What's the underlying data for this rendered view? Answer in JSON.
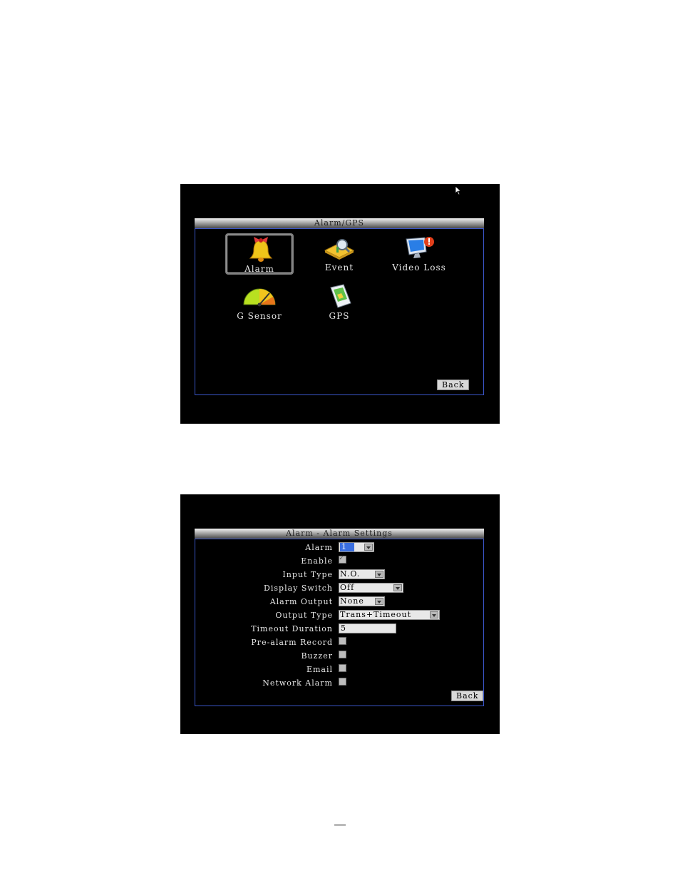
{
  "screen1": {
    "title": "Alarm/GPS",
    "items": [
      {
        "label": "Alarm",
        "icon": "bell-icon"
      },
      {
        "label": "Event",
        "icon": "event-icon"
      },
      {
        "label": "Video Loss",
        "icon": "monitor-alert-icon"
      },
      {
        "label": "G Sensor",
        "icon": "gauge-icon"
      },
      {
        "label": "GPS",
        "icon": "gps-device-icon"
      }
    ],
    "back_label": "Back"
  },
  "screen2": {
    "title": "Alarm - Alarm Settings",
    "fields": {
      "alarm": {
        "label": "Alarm",
        "value": "1"
      },
      "enable": {
        "label": "Enable",
        "checked": true
      },
      "input_type": {
        "label": "Input Type",
        "value": "N.O."
      },
      "display_switch": {
        "label": "Display Switch",
        "value": "Off"
      },
      "alarm_output": {
        "label": "Alarm Output",
        "value": "None"
      },
      "output_type": {
        "label": "Output Type",
        "value": "Trans+Timeout"
      },
      "timeout_duration": {
        "label": "Timeout Duration",
        "value": "5"
      },
      "pre_alarm_record": {
        "label": "Pre-alarm Record",
        "checked": false
      },
      "buzzer": {
        "label": "Buzzer",
        "checked": false
      },
      "email": {
        "label": "Email",
        "checked": false
      },
      "network_alarm": {
        "label": "Network Alarm",
        "checked": false
      }
    },
    "back_label": "Back"
  },
  "colors": {
    "accent_border": "#3a55c8",
    "focus": "#3a6fe0"
  }
}
